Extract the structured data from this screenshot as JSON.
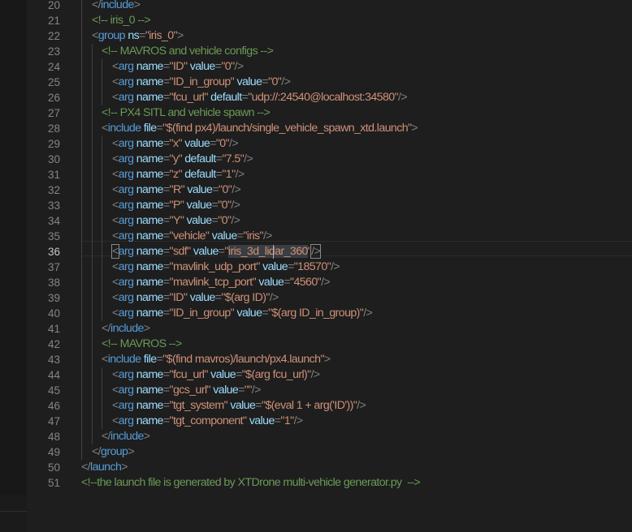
{
  "editor": {
    "active_line": "36",
    "lines": [
      {
        "n": "20",
        "indent": 1,
        "tokens": [
          [
            "punc",
            "</"
          ],
          [
            "tag",
            "include"
          ],
          [
            "punc",
            ">"
          ]
        ]
      },
      {
        "n": "21",
        "indent": 1,
        "tokens": [
          [
            "comm",
            "<!-- iris_0 -->"
          ]
        ]
      },
      {
        "n": "22",
        "indent": 1,
        "tokens": [
          [
            "punc",
            "<"
          ],
          [
            "tag",
            "group"
          ],
          [
            "plain",
            " "
          ],
          [
            "attr",
            "ns"
          ],
          [
            "punc",
            "="
          ],
          [
            "str",
            "\"iris_0\""
          ],
          [
            "punc",
            ">"
          ]
        ]
      },
      {
        "n": "23",
        "indent": 2,
        "tokens": [
          [
            "comm",
            "<!-- MAVROS and vehicle configs -->"
          ]
        ]
      },
      {
        "n": "24",
        "indent": 3,
        "tokens": [
          [
            "punc",
            "<"
          ],
          [
            "tag",
            "arg"
          ],
          [
            "plain",
            " "
          ],
          [
            "attr",
            "name"
          ],
          [
            "punc",
            "="
          ],
          [
            "str",
            "\"ID\""
          ],
          [
            "plain",
            " "
          ],
          [
            "attr",
            "value"
          ],
          [
            "punc",
            "="
          ],
          [
            "str",
            "\"0\""
          ],
          [
            "punc",
            "/>"
          ]
        ]
      },
      {
        "n": "25",
        "indent": 3,
        "tokens": [
          [
            "punc",
            "<"
          ],
          [
            "tag",
            "arg"
          ],
          [
            "plain",
            " "
          ],
          [
            "attr",
            "name"
          ],
          [
            "punc",
            "="
          ],
          [
            "str",
            "\"ID_in_group\""
          ],
          [
            "plain",
            " "
          ],
          [
            "attr",
            "value"
          ],
          [
            "punc",
            "="
          ],
          [
            "str",
            "\"0\""
          ],
          [
            "punc",
            "/>"
          ]
        ]
      },
      {
        "n": "26",
        "indent": 3,
        "tokens": [
          [
            "punc",
            "<"
          ],
          [
            "tag",
            "arg"
          ],
          [
            "plain",
            " "
          ],
          [
            "attr",
            "name"
          ],
          [
            "punc",
            "="
          ],
          [
            "str",
            "\"fcu_url\""
          ],
          [
            "plain",
            " "
          ],
          [
            "attr",
            "default"
          ],
          [
            "punc",
            "="
          ],
          [
            "str",
            "\"udp://:24540@localhost:34580\""
          ],
          [
            "punc",
            "/>"
          ]
        ]
      },
      {
        "n": "27",
        "indent": 2,
        "tokens": [
          [
            "comm",
            "<!-- PX4 SITL and vehicle spawn -->"
          ]
        ]
      },
      {
        "n": "28",
        "indent": 2,
        "tokens": [
          [
            "punc",
            "<"
          ],
          [
            "tag",
            "include"
          ],
          [
            "plain",
            " "
          ],
          [
            "attr",
            "file"
          ],
          [
            "punc",
            "="
          ],
          [
            "str",
            "\"$(find px4)/launch/single_vehicle_spawn_xtd.launch\""
          ],
          [
            "punc",
            ">"
          ]
        ]
      },
      {
        "n": "29",
        "indent": 3,
        "tokens": [
          [
            "punc",
            "<"
          ],
          [
            "tag",
            "arg"
          ],
          [
            "plain",
            " "
          ],
          [
            "attr",
            "name"
          ],
          [
            "punc",
            "="
          ],
          [
            "str",
            "\"x\""
          ],
          [
            "plain",
            " "
          ],
          [
            "attr",
            "value"
          ],
          [
            "punc",
            "="
          ],
          [
            "str",
            "\"0\""
          ],
          [
            "punc",
            "/>"
          ]
        ]
      },
      {
        "n": "30",
        "indent": 3,
        "tokens": [
          [
            "punc",
            "<"
          ],
          [
            "tag",
            "arg"
          ],
          [
            "plain",
            " "
          ],
          [
            "attr",
            "name"
          ],
          [
            "punc",
            "="
          ],
          [
            "str",
            "\"y\""
          ],
          [
            "plain",
            " "
          ],
          [
            "attr",
            "default"
          ],
          [
            "punc",
            "="
          ],
          [
            "str",
            "\"7.5\""
          ],
          [
            "punc",
            "/>"
          ]
        ]
      },
      {
        "n": "31",
        "indent": 3,
        "tokens": [
          [
            "punc",
            "<"
          ],
          [
            "tag",
            "arg"
          ],
          [
            "plain",
            " "
          ],
          [
            "attr",
            "name"
          ],
          [
            "punc",
            "="
          ],
          [
            "str",
            "\"z\""
          ],
          [
            "plain",
            " "
          ],
          [
            "attr",
            "default"
          ],
          [
            "punc",
            "="
          ],
          [
            "str",
            "\"1\""
          ],
          [
            "punc",
            "/>"
          ]
        ]
      },
      {
        "n": "32",
        "indent": 3,
        "tokens": [
          [
            "punc",
            "<"
          ],
          [
            "tag",
            "arg"
          ],
          [
            "plain",
            " "
          ],
          [
            "attr",
            "name"
          ],
          [
            "punc",
            "="
          ],
          [
            "str",
            "\"R\""
          ],
          [
            "plain",
            " "
          ],
          [
            "attr",
            "value"
          ],
          [
            "punc",
            "="
          ],
          [
            "str",
            "\"0\""
          ],
          [
            "punc",
            "/>"
          ]
        ]
      },
      {
        "n": "33",
        "indent": 3,
        "tokens": [
          [
            "punc",
            "<"
          ],
          [
            "tag",
            "arg"
          ],
          [
            "plain",
            " "
          ],
          [
            "attr",
            "name"
          ],
          [
            "punc",
            "="
          ],
          [
            "str",
            "\"P\""
          ],
          [
            "plain",
            " "
          ],
          [
            "attr",
            "value"
          ],
          [
            "punc",
            "="
          ],
          [
            "str",
            "\"0\""
          ],
          [
            "punc",
            "/>"
          ]
        ]
      },
      {
        "n": "34",
        "indent": 3,
        "tokens": [
          [
            "punc",
            "<"
          ],
          [
            "tag",
            "arg"
          ],
          [
            "plain",
            " "
          ],
          [
            "attr",
            "name"
          ],
          [
            "punc",
            "="
          ],
          [
            "str",
            "\"Y\""
          ],
          [
            "plain",
            " "
          ],
          [
            "attr",
            "value"
          ],
          [
            "punc",
            "="
          ],
          [
            "str",
            "\"0\""
          ],
          [
            "punc",
            "/>"
          ]
        ]
      },
      {
        "n": "35",
        "indent": 3,
        "tokens": [
          [
            "punc",
            "<"
          ],
          [
            "tag",
            "arg"
          ],
          [
            "plain",
            " "
          ],
          [
            "attr",
            "name"
          ],
          [
            "punc",
            "="
          ],
          [
            "str",
            "\"vehicle\""
          ],
          [
            "plain",
            " "
          ],
          [
            "attr",
            "value"
          ],
          [
            "punc",
            "="
          ],
          [
            "str",
            "\"iris\""
          ],
          [
            "punc",
            "/>"
          ]
        ]
      },
      {
        "n": "36",
        "indent": 3,
        "tokens": [
          [
            "punc box",
            "<"
          ],
          [
            "tag",
            "arg"
          ],
          [
            "plain",
            " "
          ],
          [
            "attr",
            "name"
          ],
          [
            "punc",
            "="
          ],
          [
            "str",
            "\"sdf\""
          ],
          [
            "plain",
            " "
          ],
          [
            "attr",
            "value"
          ],
          [
            "punc",
            "="
          ],
          [
            "str",
            "\""
          ],
          [
            "str sel",
            "iris_3d_lidar_360"
          ],
          [
            "str",
            "\""
          ],
          [
            "punc box",
            "/>"
          ]
        ]
      },
      {
        "n": "37",
        "indent": 3,
        "tokens": [
          [
            "punc",
            "<"
          ],
          [
            "tag",
            "arg"
          ],
          [
            "plain",
            " "
          ],
          [
            "attr",
            "name"
          ],
          [
            "punc",
            "="
          ],
          [
            "str",
            "\"mavlink_udp_port\""
          ],
          [
            "plain",
            " "
          ],
          [
            "attr",
            "value"
          ],
          [
            "punc",
            "="
          ],
          [
            "str",
            "\"18570\""
          ],
          [
            "punc",
            "/>"
          ]
        ]
      },
      {
        "n": "38",
        "indent": 3,
        "tokens": [
          [
            "punc",
            "<"
          ],
          [
            "tag",
            "arg"
          ],
          [
            "plain",
            " "
          ],
          [
            "attr",
            "name"
          ],
          [
            "punc",
            "="
          ],
          [
            "str",
            "\"mavlink_tcp_port\""
          ],
          [
            "plain",
            " "
          ],
          [
            "attr",
            "value"
          ],
          [
            "punc",
            "="
          ],
          [
            "str",
            "\"4560\""
          ],
          [
            "punc",
            "/>"
          ]
        ]
      },
      {
        "n": "39",
        "indent": 3,
        "tokens": [
          [
            "punc",
            "<"
          ],
          [
            "tag",
            "arg"
          ],
          [
            "plain",
            " "
          ],
          [
            "attr",
            "name"
          ],
          [
            "punc",
            "="
          ],
          [
            "str",
            "\"ID\""
          ],
          [
            "plain",
            " "
          ],
          [
            "attr",
            "value"
          ],
          [
            "punc",
            "="
          ],
          [
            "str",
            "\"$(arg ID)\""
          ],
          [
            "punc",
            "/>"
          ]
        ]
      },
      {
        "n": "40",
        "indent": 3,
        "tokens": [
          [
            "punc",
            "<"
          ],
          [
            "tag",
            "arg"
          ],
          [
            "plain",
            " "
          ],
          [
            "attr",
            "name"
          ],
          [
            "punc",
            "="
          ],
          [
            "str",
            "\"ID_in_group\""
          ],
          [
            "plain",
            " "
          ],
          [
            "attr",
            "value"
          ],
          [
            "punc",
            "="
          ],
          [
            "str",
            "\"$(arg ID_in_group)\""
          ],
          [
            "punc",
            "/>"
          ]
        ]
      },
      {
        "n": "41",
        "indent": 2,
        "tokens": [
          [
            "punc",
            "</"
          ],
          [
            "tag",
            "include"
          ],
          [
            "punc",
            ">"
          ]
        ]
      },
      {
        "n": "42",
        "indent": 2,
        "tokens": [
          [
            "comm",
            "<!-- MAVROS -->"
          ]
        ]
      },
      {
        "n": "43",
        "indent": 2,
        "tokens": [
          [
            "punc",
            "<"
          ],
          [
            "tag",
            "include"
          ],
          [
            "plain",
            " "
          ],
          [
            "attr",
            "file"
          ],
          [
            "punc",
            "="
          ],
          [
            "str",
            "\"$(find mavros)/launch/px4.launch\""
          ],
          [
            "punc",
            ">"
          ]
        ]
      },
      {
        "n": "44",
        "indent": 3,
        "tokens": [
          [
            "punc",
            "<"
          ],
          [
            "tag",
            "arg"
          ],
          [
            "plain",
            " "
          ],
          [
            "attr",
            "name"
          ],
          [
            "punc",
            "="
          ],
          [
            "str",
            "\"fcu_url\""
          ],
          [
            "plain",
            " "
          ],
          [
            "attr",
            "value"
          ],
          [
            "punc",
            "="
          ],
          [
            "str",
            "\"$(arg fcu_url)\""
          ],
          [
            "punc",
            "/>"
          ]
        ]
      },
      {
        "n": "45",
        "indent": 3,
        "tokens": [
          [
            "punc",
            "<"
          ],
          [
            "tag",
            "arg"
          ],
          [
            "plain",
            " "
          ],
          [
            "attr",
            "name"
          ],
          [
            "punc",
            "="
          ],
          [
            "str",
            "\"gcs_url\""
          ],
          [
            "plain",
            " "
          ],
          [
            "attr",
            "value"
          ],
          [
            "punc",
            "="
          ],
          [
            "str",
            "\"\""
          ],
          [
            "punc",
            "/>"
          ]
        ]
      },
      {
        "n": "46",
        "indent": 3,
        "tokens": [
          [
            "punc",
            "<"
          ],
          [
            "tag",
            "arg"
          ],
          [
            "plain",
            " "
          ],
          [
            "attr",
            "name"
          ],
          [
            "punc",
            "="
          ],
          [
            "str",
            "\"tgt_system\""
          ],
          [
            "plain",
            " "
          ],
          [
            "attr",
            "value"
          ],
          [
            "punc",
            "="
          ],
          [
            "str",
            "\"$(eval 1 + arg('ID'))\""
          ],
          [
            "punc",
            "/>"
          ]
        ]
      },
      {
        "n": "47",
        "indent": 3,
        "tokens": [
          [
            "punc",
            "<"
          ],
          [
            "tag",
            "arg"
          ],
          [
            "plain",
            " "
          ],
          [
            "attr",
            "name"
          ],
          [
            "punc",
            "="
          ],
          [
            "str",
            "\"tgt_component\""
          ],
          [
            "plain",
            " "
          ],
          [
            "attr",
            "value"
          ],
          [
            "punc",
            "="
          ],
          [
            "str",
            "\"1\""
          ],
          [
            "punc",
            "/>"
          ]
        ]
      },
      {
        "n": "48",
        "indent": 2,
        "tokens": [
          [
            "punc",
            "</"
          ],
          [
            "tag",
            "include"
          ],
          [
            "punc",
            ">"
          ]
        ]
      },
      {
        "n": "49",
        "indent": 1,
        "tokens": [
          [
            "punc",
            "</"
          ],
          [
            "tag",
            "group"
          ],
          [
            "punc",
            ">"
          ]
        ]
      },
      {
        "n": "50",
        "indent": 0,
        "tokens": [
          [
            "punc",
            "</"
          ],
          [
            "tag",
            "launch"
          ],
          [
            "punc",
            ">"
          ]
        ]
      },
      {
        "n": "51",
        "indent": 0,
        "tokens": [
          [
            "comm",
            "<!--the launch file is generated by XTDrone multi-vehicle generator.py  -->"
          ]
        ]
      }
    ]
  }
}
